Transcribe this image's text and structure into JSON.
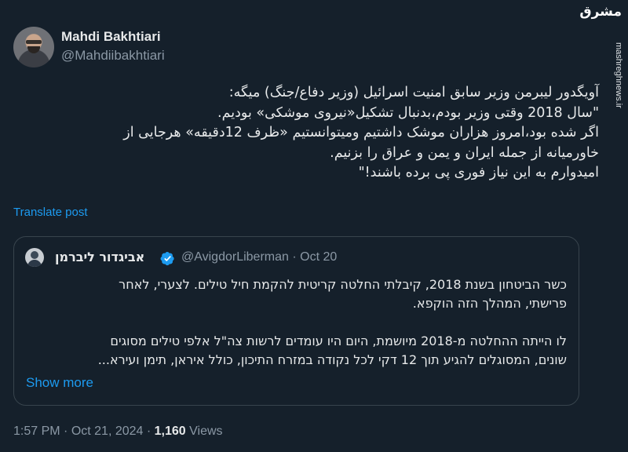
{
  "author": {
    "name": "Mahdi Bakhtiari",
    "handle": "@Mahdiibakhtiari"
  },
  "watermark": {
    "logo_text": "مشرق",
    "url": "mashreghnews.ir"
  },
  "post": {
    "lines": [
      "آویگدور لیبرمن وزیر سابق امنیت اسرائیل (وزیر دفاع/جنگ) میگه:",
      "\"سال 2018 وقتی وزیر بودم،بدنبال تشکیل«نیروی موشکی» بودیم.",
      "اگر شده بود،امروز هزاران موشک داشتیم ومیتوانستیم «ظرف 12دقیقه» هرجایی از",
      "خاورمیانه از جمله ایران و یمن و عراق را بزنیم.",
      "امیدوارم به این نیاز فوری پی برده باشند!\""
    ],
    "translate_label": "Translate post"
  },
  "quote": {
    "name": "אביגדור ליברמן",
    "handle": "@AvigdorLiberman",
    "separator": " · ",
    "date": "Oct 20",
    "lines_a": [
      "כשר הביטחון בשנת 2018, קיבלתי החלטה קריטית להקמת חיל טילים. לצערי, לאחר",
      "פרישתי, המהלך הזה הוקפא."
    ],
    "lines_b": [
      "לו הייתה ההחלטה מ-2018 מיושמת, היום היו עומדים לרשות צה\"ל אלפי טילים מסוגים",
      "שונים, המסוגלים להגיע תוך 12 דקי לכל נקודה במזרח התיכון, כולל איראן, תימן ועירא..."
    ],
    "show_more_label": "Show more",
    "verified_color": "#1d9bf0"
  },
  "footer": {
    "time": "1:57 PM",
    "separator": " · ",
    "date": "Oct 21, 2024",
    "views_count": "1,160",
    "views_label": " Views"
  }
}
